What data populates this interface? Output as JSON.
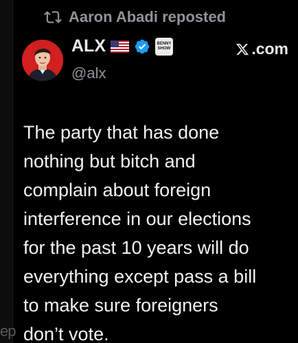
{
  "repost": {
    "text": "Aaron Abadi reposted",
    "icon": "repost-icon"
  },
  "author": {
    "display_name": "ALX",
    "handle": "@alx",
    "flag_icon": "us-flag-icon",
    "verified_icon": "verified-badge-icon",
    "badge_text": "BENNY SHOW"
  },
  "source": {
    "text": ".com",
    "icon": "x-logo-icon"
  },
  "tweet": {
    "lines": [
      "The party that has done",
      "nothing but bitch and",
      "complain about foreign",
      "interference in our elections",
      "for the past 10 years will do",
      "everything except pass a bill",
      "to make sure foreigners",
      "don’t vote."
    ]
  },
  "background_fragment": {
    "text": "ep"
  },
  "colors": {
    "background": "#000000",
    "text": "#e7e9ea",
    "muted": "#8f9499",
    "verified": "#1d9bf0",
    "avatar_bg": "#d21f1f"
  }
}
